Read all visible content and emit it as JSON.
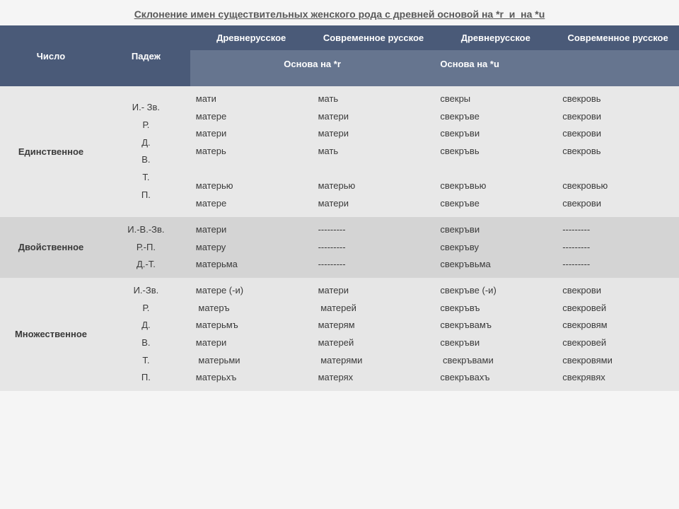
{
  "title": "Склонение имен существительных женского рода с древней основой на *r  и  на *u",
  "header": {
    "number": "Число",
    "case": "Падеж",
    "old": "Древнерусское",
    "modern": "Современное русское",
    "stem_r": "Основа на *r",
    "stem_u": "Основа на *u"
  },
  "rows": {
    "sg": {
      "label": "Единственное",
      "cases": "И.- Зв.\nР.\nД.\nВ.\nТ.\nП.",
      "c1": "мати\nматере\nматери\nматерь\n\nматерью\nматере",
      "c2": "мать\nматери\nматери\nмать\n\nматерью\nматери",
      "c3": "свекры\nсвекръве\nсвекръви\nсвекръвь\n\nсвекръвью\nсвекръве",
      "c4": "свекровь\nсвекрови\nсвекрови\nсвекровь\n\nсвекровью\nсвекрови"
    },
    "du": {
      "label": "Двойственное",
      "cases": "И.-В.-Зв.\nР.-П.\nД.-Т.",
      "c1": "матери\nматеру\nматерьма",
      "c2": "---------\n---------\n---------",
      "c3": "свекръви\nсвекръву\nсвекръвьма",
      "c4": "---------\n---------\n---------"
    },
    "pl": {
      "label": "Множественное",
      "cases": "И.-Зв.\nР.\nД.\nВ.\nТ.\nП.",
      "c1": "матере (-и)\n матеръ\nматерьмъ\nматери\n матерьми\nматерьхъ",
      "c2": "матери\n матерей\nматерям\nматерей\n матерями\nматерях",
      "c3": "свекръве (-и)\nсвекръвъ\nсвекръвамъ\nсвекръви\n свекръвами\nсвекръвахъ",
      "c4": "свекрови\nсвекровей\nсвекровям\nсвекровей\nсвекровями\nсвекрявях"
    }
  }
}
